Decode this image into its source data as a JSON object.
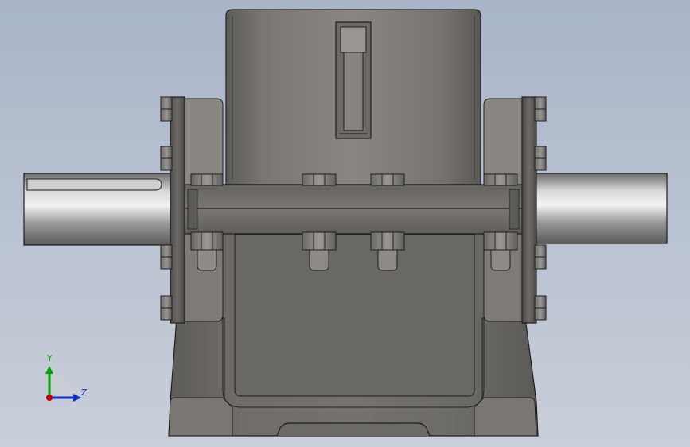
{
  "viewport": {
    "background_top": "#a9b5c8",
    "background_bottom": "#c9cfd9"
  },
  "model": {
    "body_color": "#7a7874",
    "edge_color": "#1e1e1e",
    "shaft_color": "#8c8c8c"
  },
  "triad": {
    "y_label": "Y",
    "z_label": "Z",
    "y_color": "#00a000",
    "z_color": "#1030c0",
    "x_color": "#c00000"
  }
}
